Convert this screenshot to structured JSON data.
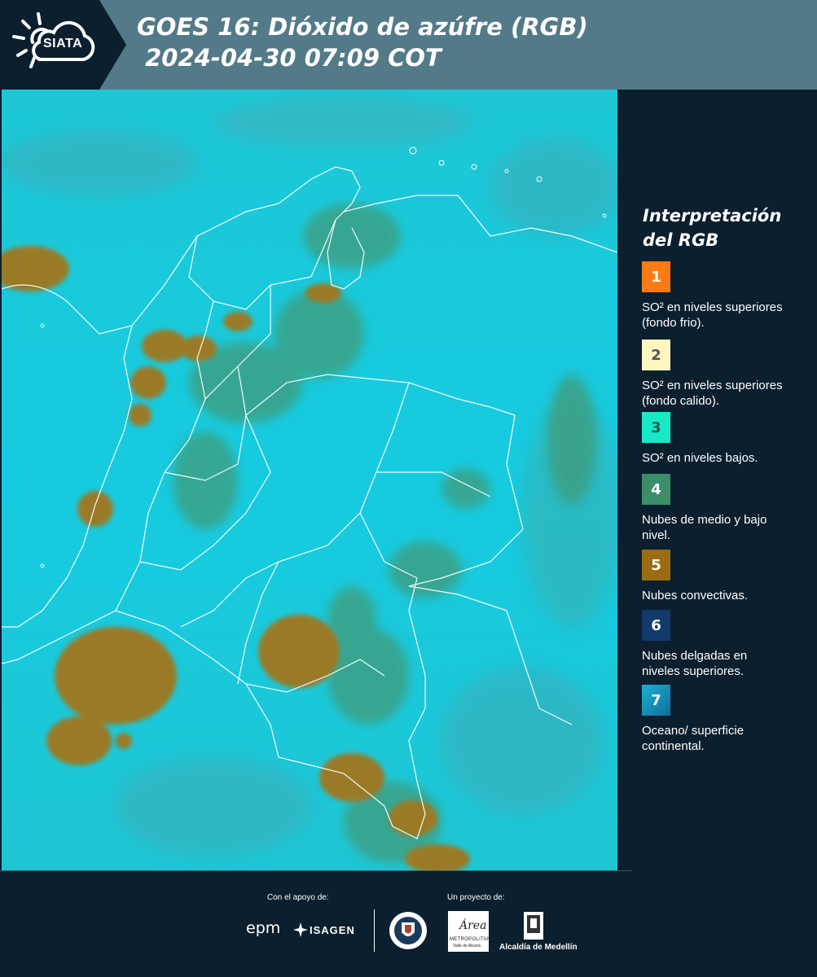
{
  "header": {
    "logo_text": "SIATA",
    "title_line1": "GOES 16: Dióxido de azúfre (RGB)",
    "title_line2": " 2024-04-30 07:09 COT",
    "background": "#527a88"
  },
  "map": {
    "background_color": "#16c9dc",
    "cloud_colors": {
      "convective": "#9a7a28",
      "mid_low": "#3f9b7a",
      "surface": "#16c9dc"
    },
    "border_color": "#ffffff"
  },
  "legend": {
    "title_line1": "Interpretación",
    "title_line2": "del RGB",
    "items": [
      {
        "number": "1",
        "color": "#ff7a10",
        "number_color": "#ffffff",
        "label": "SO² en niveles superiores (fondo frio)."
      },
      {
        "number": "2",
        "color": "#fff6c2",
        "number_color": "#555555",
        "label": "SO² en niveles superiores (fondo calido)."
      },
      {
        "number": "3",
        "color": "#18e8c6",
        "number_color": "#2a5a55",
        "label": "SO² en niveles bajos."
      },
      {
        "number": "4",
        "color": "#3a8f68",
        "number_color": "#ffffff",
        "label": "Nubes de medio y bajo nivel."
      },
      {
        "number": "5",
        "color": "#9b6c12",
        "number_color": "#ffffff",
        "label": "Nubes convectivas."
      },
      {
        "number": "6",
        "color": "#123a6b",
        "number_color": "#ffffff",
        "label": "Nubes delgadas en niveles superiores."
      },
      {
        "number": "7",
        "color": "#1590b8",
        "number_color": "#ffffff",
        "label": "Oceano/ superficie continental."
      }
    ]
  },
  "footer": {
    "support_label": "Con el apoyo de:",
    "project_label": "Un proyecto de:",
    "sponsor_1": "epm",
    "sponsor_2": "ISAGEN",
    "area_word": "Área",
    "area_sub1": "METROPOLITANA",
    "area_sub2": "Valle de Aburrá",
    "alcaldia_label": "Alcaldía de Medellín"
  }
}
